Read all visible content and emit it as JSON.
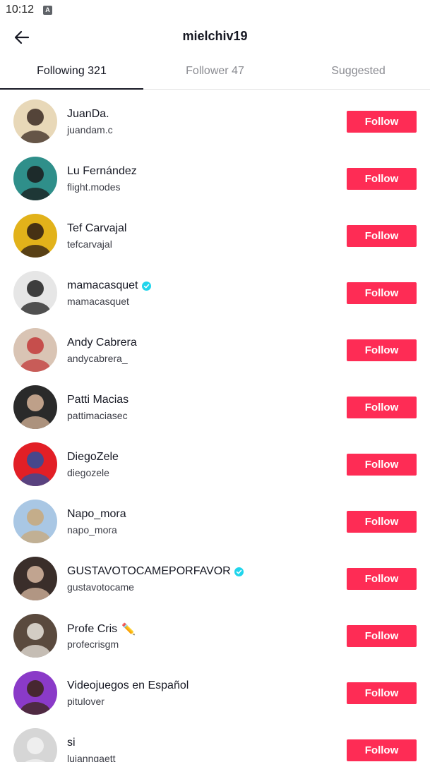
{
  "status_bar": {
    "time": "10:12",
    "notification_icon": "a-icon"
  },
  "header": {
    "title": "mielchiv19",
    "back_icon": "arrow-left-icon"
  },
  "tabs": [
    {
      "label": "Following 321",
      "active": true
    },
    {
      "label": "Follower 47",
      "active": false
    },
    {
      "label": "Suggested",
      "active": false
    }
  ],
  "follow_button_color": "#fe2c55",
  "verified_color": "#20d5ec",
  "users": [
    {
      "name": "JuanDa.",
      "handle": "juandam.c",
      "verified": false,
      "emoji": "",
      "button": "Follow",
      "avatar_colors": [
        "#e8d8b8",
        "#3a2a22"
      ]
    },
    {
      "name": "Lu Fernández",
      "handle": "flight.modes",
      "verified": false,
      "emoji": "",
      "button": "Follow",
      "avatar_colors": [
        "#2f8f8a",
        "#1a1a1a"
      ]
    },
    {
      "name": "Tef Carvajal",
      "handle": "tefcarvajal",
      "verified": false,
      "emoji": "",
      "button": "Follow",
      "avatar_colors": [
        "#e2b21a",
        "#2a1a14"
      ]
    },
    {
      "name": "mamacasquet",
      "handle": "mamacasquet",
      "verified": true,
      "emoji": "",
      "button": "Follow",
      "avatar_colors": [
        "#e6e6e6",
        "#1e1e1e"
      ]
    },
    {
      "name": "Andy Cabrera",
      "handle": "andycabrera_",
      "verified": false,
      "emoji": "",
      "button": "Follow",
      "avatar_colors": [
        "#d9c4b4",
        "#c23a3a"
      ]
    },
    {
      "name": "Patti Macias",
      "handle": "pattimaciasec",
      "verified": false,
      "emoji": "",
      "button": "Follow",
      "avatar_colors": [
        "#2a2a2a",
        "#d8b59a"
      ]
    },
    {
      "name": "DiegoZele",
      "handle": "diegozele",
      "verified": false,
      "emoji": "",
      "button": "Follow",
      "avatar_colors": [
        "#e21f26",
        "#2b4f9e"
      ]
    },
    {
      "name": "Napo_mora",
      "handle": "napo_mora",
      "verified": false,
      "emoji": "",
      "button": "Follow",
      "avatar_colors": [
        "#a9c7e4",
        "#c9a87a"
      ]
    },
    {
      "name": "GUSTAVOTOCAMEPORFAVOR",
      "handle": "gustavotocame",
      "verified": true,
      "emoji": "",
      "button": "Follow",
      "avatar_colors": [
        "#3a2e2a",
        "#d9b9a2"
      ]
    },
    {
      "name": "Profe Cris",
      "handle": "profecrisgm",
      "verified": false,
      "emoji": "✏️",
      "button": "Follow",
      "avatar_colors": [
        "#5a4a3e",
        "#e9e4dc"
      ]
    },
    {
      "name": "Videojuegos en Español",
      "handle": "pitulover",
      "verified": false,
      "emoji": "",
      "button": "Follow",
      "avatar_colors": [
        "#8a3ac8",
        "#3b2516"
      ]
    },
    {
      "name": "si",
      "handle": "lujanngaett",
      "verified": false,
      "emoji": "",
      "button": "Follow",
      "avatar_colors": [
        "#d6d6d6",
        "#f2f2f2"
      ]
    }
  ]
}
